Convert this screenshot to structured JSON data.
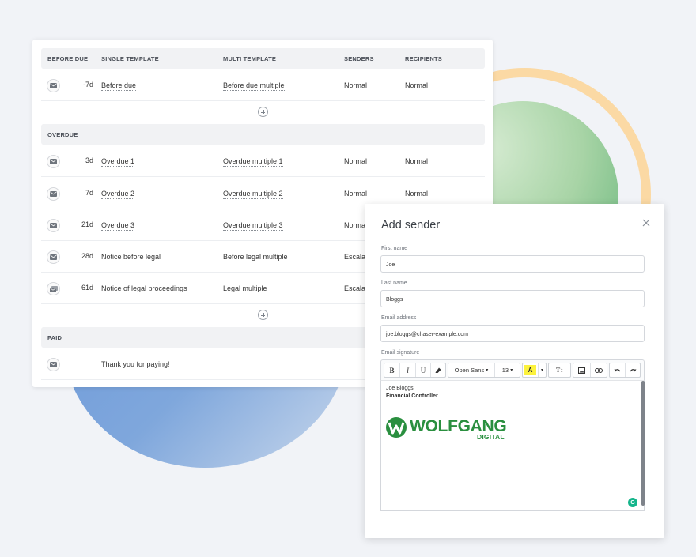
{
  "table": {
    "sections": [
      {
        "id": "before_due",
        "header": [
          "BEFORE DUE",
          "SINGLE TEMPLATE",
          "MULTI TEMPLATE",
          "SENDERS",
          "RECIPIENTS"
        ],
        "rows": [
          {
            "days": "-7d",
            "single": "Before due",
            "multi": "Before due multiple",
            "senders": "Normal",
            "recipients": "Normal"
          }
        ]
      },
      {
        "id": "overdue",
        "header": [
          "OVERDUE"
        ],
        "rows": [
          {
            "days": "3d",
            "single": "Overdue 1",
            "multi": "Overdue multiple 1",
            "senders": "Normal",
            "recipients": "Normal"
          },
          {
            "days": "7d",
            "single": "Overdue 2",
            "multi": "Overdue multiple 2",
            "senders": "Normal",
            "recipients": "Normal"
          },
          {
            "days": "21d",
            "single": "Overdue 3",
            "multi": "Overdue multiple 3",
            "senders": "Normal",
            "recipients": ""
          },
          {
            "days": "28d",
            "single": "Notice before legal",
            "multi": "Before legal multiple",
            "senders": "Escalat",
            "recipients": ""
          },
          {
            "days": "61d",
            "single": "Notice of legal proceedings",
            "multi": "Legal multiple",
            "senders": "Escalat",
            "recipients": ""
          }
        ]
      },
      {
        "id": "paid",
        "header": [
          "PAID"
        ],
        "rows": [
          {
            "days": "",
            "single": "Thank you for paying!",
            "multi": "",
            "senders": "",
            "recipients": ""
          }
        ]
      }
    ],
    "icons": {
      "row": "envelope-icon",
      "add": "plus-circle-icon"
    }
  },
  "modal": {
    "title": "Add sender",
    "fields": {
      "first_name": {
        "label": "First name",
        "value": "Joe"
      },
      "last_name": {
        "label": "Last name",
        "value": "Bloggs"
      },
      "email": {
        "label": "Email address",
        "value": "joe.bloggs@chaser-example.com"
      },
      "signature_label": "Email signature"
    },
    "toolbar": {
      "bold": "B",
      "italic": "I",
      "underline": "U",
      "font": "Open Sans",
      "size": "13",
      "text_color": "A",
      "text_style": "T↕"
    },
    "signature": {
      "line1": "Joe Bloggs",
      "line2": "Financial Controller",
      "logo_text": "WOLFGANG",
      "logo_sub": "DIGITAL"
    }
  },
  "colors": {
    "brand_green": "#2a8f3f",
    "ring": "#fbd9a4",
    "grammarly": "#15b58b"
  }
}
